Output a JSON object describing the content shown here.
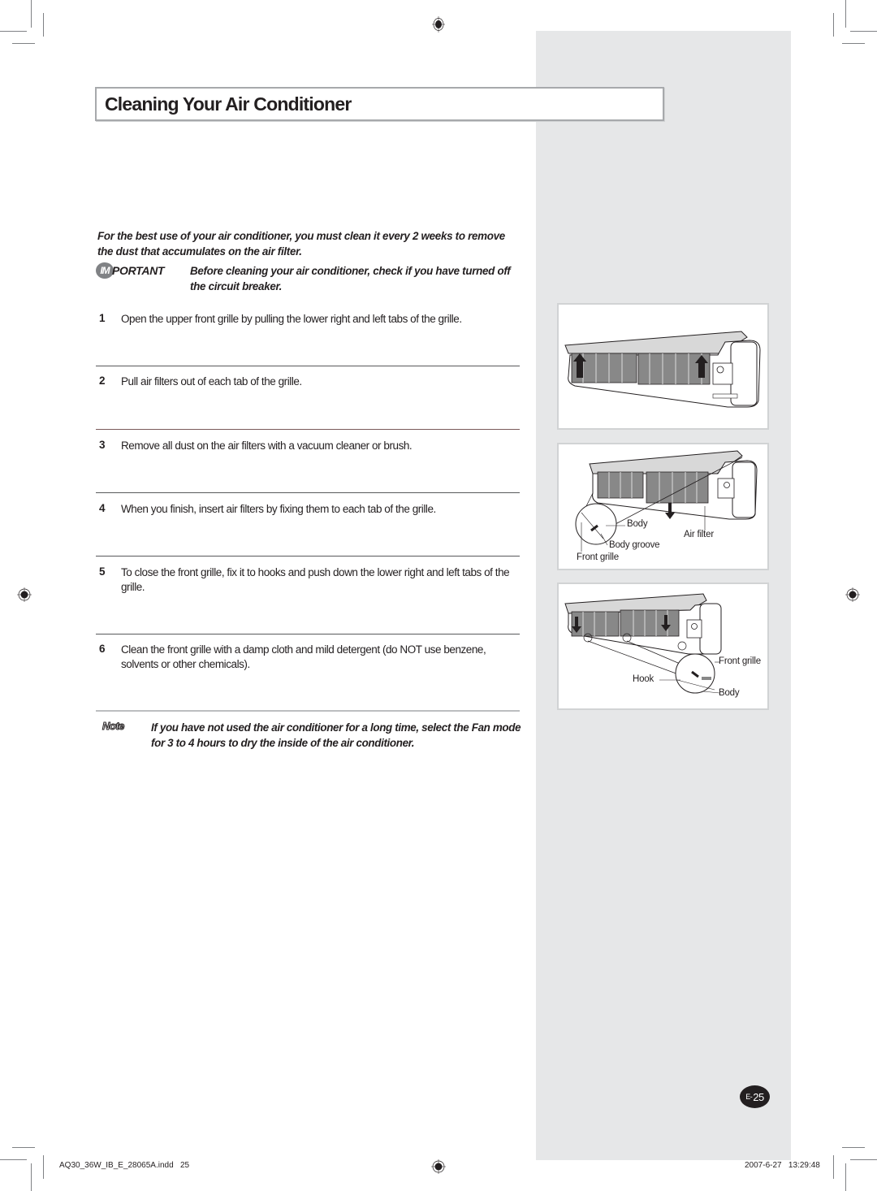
{
  "header": {
    "title": "Cleaning Your Air Conditioner"
  },
  "intro": "For the best use of your air conditioner, you must clean it every 2 weeks to remove the dust that accumulates on the air filter.",
  "important": {
    "badge_circle": "IM",
    "badge_rest": "PORTANT",
    "text": "Before cleaning your air conditioner, check if you have turned off the circuit breaker."
  },
  "steps": [
    {
      "num": "1",
      "text": "Open the upper front grille by pulling the lower right and left tabs of the grille."
    },
    {
      "num": "2",
      "text": "Pull air filters out of each tab of the grille."
    },
    {
      "num": "3",
      "text": "Remove all dust on the air filters with a vacuum cleaner or brush."
    },
    {
      "num": "4",
      "text": "When you finish, insert air filters by fixing them to each tab of the grille."
    },
    {
      "num": "5",
      "text": "To close the front grille, fix it to hooks and push down the lower right and left tabs of the grille."
    },
    {
      "num": "6",
      "text": "Clean the front grille with a damp cloth and mild detergent (do NOT use benzene, solvents or other chemicals)."
    }
  ],
  "note": {
    "badge": "Note",
    "text": "If you have not used the air conditioner for a long time, select the Fan mode for 3 to 4 hours to dry the inside of the air conditioner."
  },
  "figures": [
    {
      "name": "open-grille-illustration",
      "labels": []
    },
    {
      "name": "remove-filter-illustration",
      "labels": [
        "Body",
        "Air filter",
        "Body groove",
        "Front grille"
      ]
    },
    {
      "name": "close-grille-illustration",
      "labels": [
        "Front grille",
        "Hook",
        "Body"
      ]
    }
  ],
  "page_number": {
    "prefix": "E-",
    "number": "25"
  },
  "footer": {
    "file": "AQ30_36W_IB_E_28065A.indd   25",
    "timestamp": "2007-6-27   13:29:48"
  },
  "colors": {
    "side_panel": "#e6e7e8",
    "text": "#231f20",
    "badge_gray": "#808285"
  }
}
